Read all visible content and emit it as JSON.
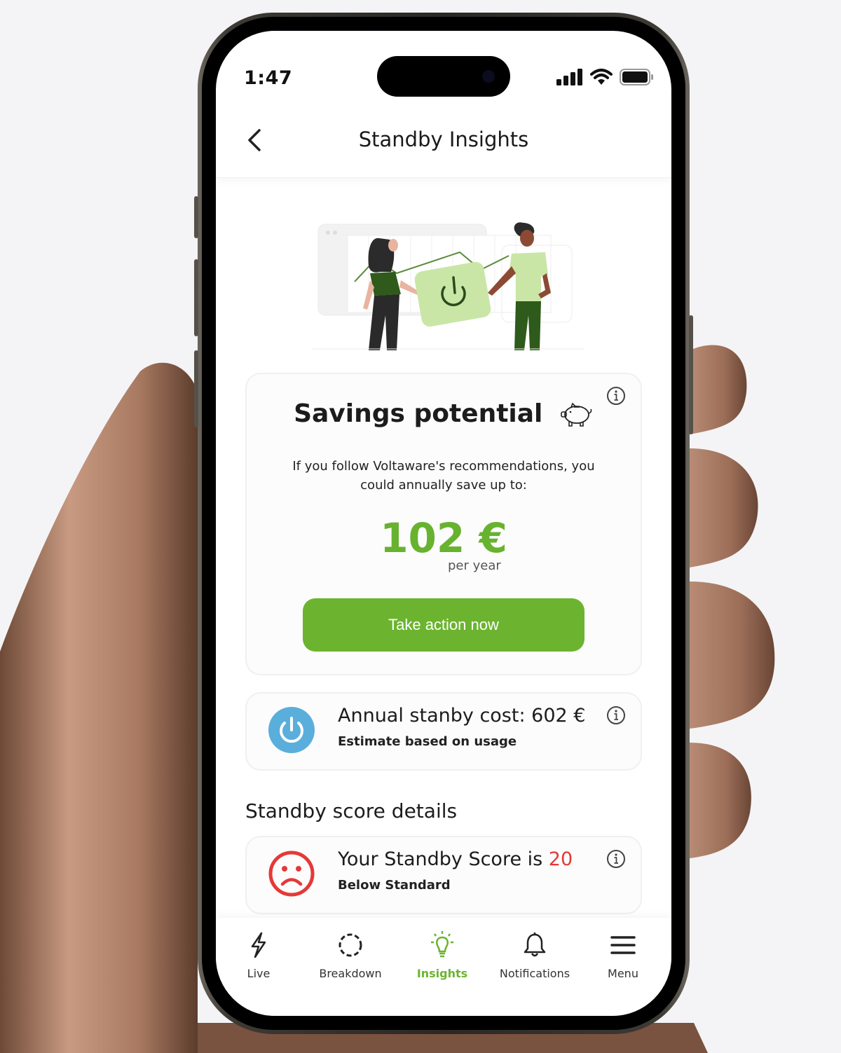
{
  "status_bar": {
    "time": "1:47"
  },
  "header": {
    "title": "Standby Insights"
  },
  "savings_card": {
    "title": "Savings potential",
    "description": "If you follow Voltaware's recommendations, you could annually save up to:",
    "amount": "102 €",
    "period": "per year",
    "button_label": "Take action now"
  },
  "cost_card": {
    "title": "Annual stanby cost: 602 €",
    "subtitle": "Estimate based  on usage"
  },
  "score_section": {
    "title": "Standby score details",
    "score_prefix": "Your Standby Score is ",
    "score_value": "20",
    "score_label": "Below Standard"
  },
  "tabs": [
    {
      "label": "Live",
      "icon": "lightning-icon",
      "active": false
    },
    {
      "label": "Breakdown",
      "icon": "dashed-circle-icon",
      "active": false
    },
    {
      "label": "Insights",
      "icon": "lightbulb-icon",
      "active": true
    },
    {
      "label": "Notifications",
      "icon": "bell-icon",
      "active": false
    },
    {
      "label": "Menu",
      "icon": "hamburger-icon",
      "active": false
    }
  ],
  "colors": {
    "accent_green": "#6cb42f",
    "amount_green": "#67b22f",
    "score_red": "#e63838",
    "power_blue": "#5aaedc"
  }
}
